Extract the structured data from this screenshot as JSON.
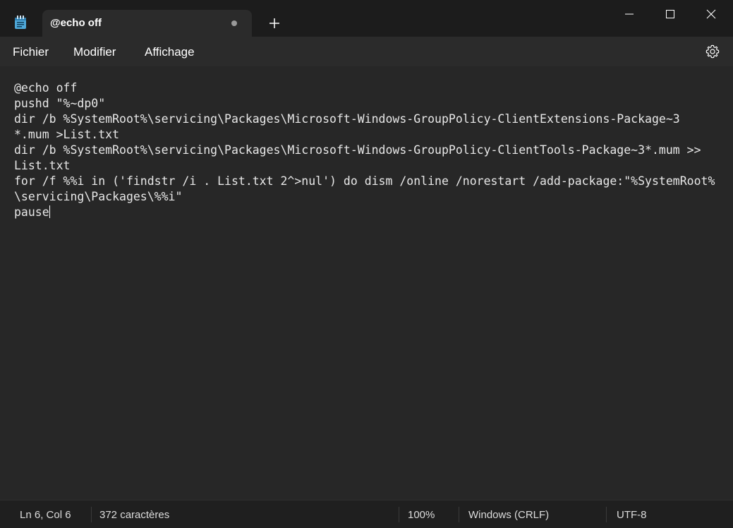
{
  "tab": {
    "title": "@echo off"
  },
  "menu": {
    "items": [
      "Fichier",
      "Modifier",
      "Affichage"
    ]
  },
  "editor": {
    "lines": [
      "@echo off",
      "pushd \"%~dp0\"",
      "dir /b %SystemRoot%\\servicing\\Packages\\Microsoft-Windows-GroupPolicy-ClientExtensions-Package~3",
      "*.mum >List.txt",
      "dir /b %SystemRoot%\\servicing\\Packages\\Microsoft-Windows-GroupPolicy-ClientTools-Package~3*.mum >>",
      "List.txt",
      "for /f %%i in ('findstr /i . List.txt 2^>nul') do dism /online /norestart /add-package:\"%SystemRoot%",
      "\\servicing\\Packages\\%%i\"",
      "pause"
    ]
  },
  "status": {
    "position": "Ln 6, Col 6",
    "characters": "372 caractères",
    "zoom": "100%",
    "line_ending": "Windows (CRLF)",
    "encoding": "UTF-8"
  },
  "icons": {
    "app": "notepad-icon",
    "tab_modified": "unsaved-dot-icon",
    "new_tab": "plus-icon",
    "minimize": "minimize-icon",
    "maximize": "maximize-icon",
    "close": "close-icon",
    "settings": "gear-icon"
  },
  "colors": {
    "titlebar": "#1c1c1c",
    "tab": "#2b2b2b",
    "editor": "#272727",
    "statusbar": "#1f1f1f",
    "text": "#ffffff",
    "app_icon_accent": "#4fa8d8"
  }
}
